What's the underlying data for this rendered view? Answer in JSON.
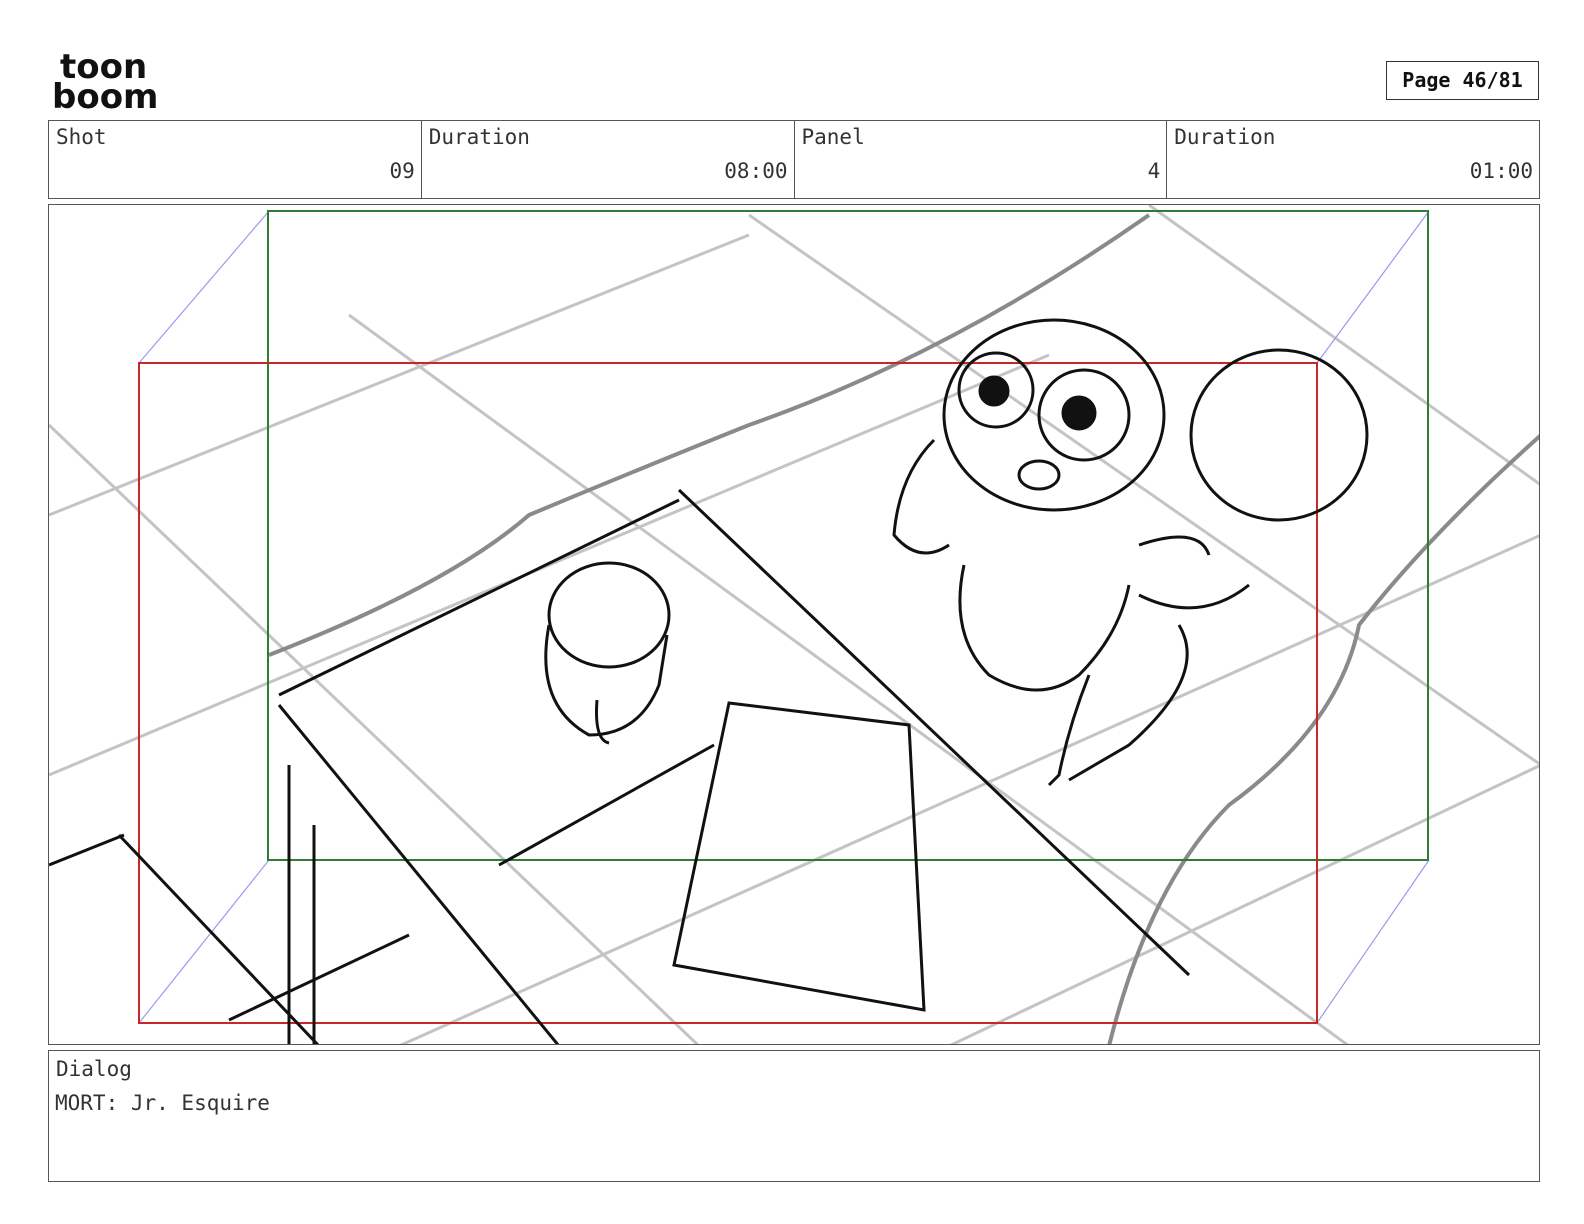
{
  "logo": {
    "line1": "toon",
    "line2": "boom",
    "icon": "toon-boom-logo"
  },
  "page_label": "Page 46/81",
  "meta": [
    {
      "label": "Shot",
      "value": "09"
    },
    {
      "label": "Duration",
      "value": "08:00"
    },
    {
      "label": "Panel",
      "value": "4"
    },
    {
      "label": "Duration",
      "value": "01:00"
    }
  ],
  "dialog": {
    "label": "Dialog",
    "text": "MORT: Jr. Esquire"
  },
  "colors": {
    "safe_frame": "#2e7d32",
    "camera_frame": "#c62828",
    "sketch": "#111111",
    "guide": "#b0b0b0"
  }
}
